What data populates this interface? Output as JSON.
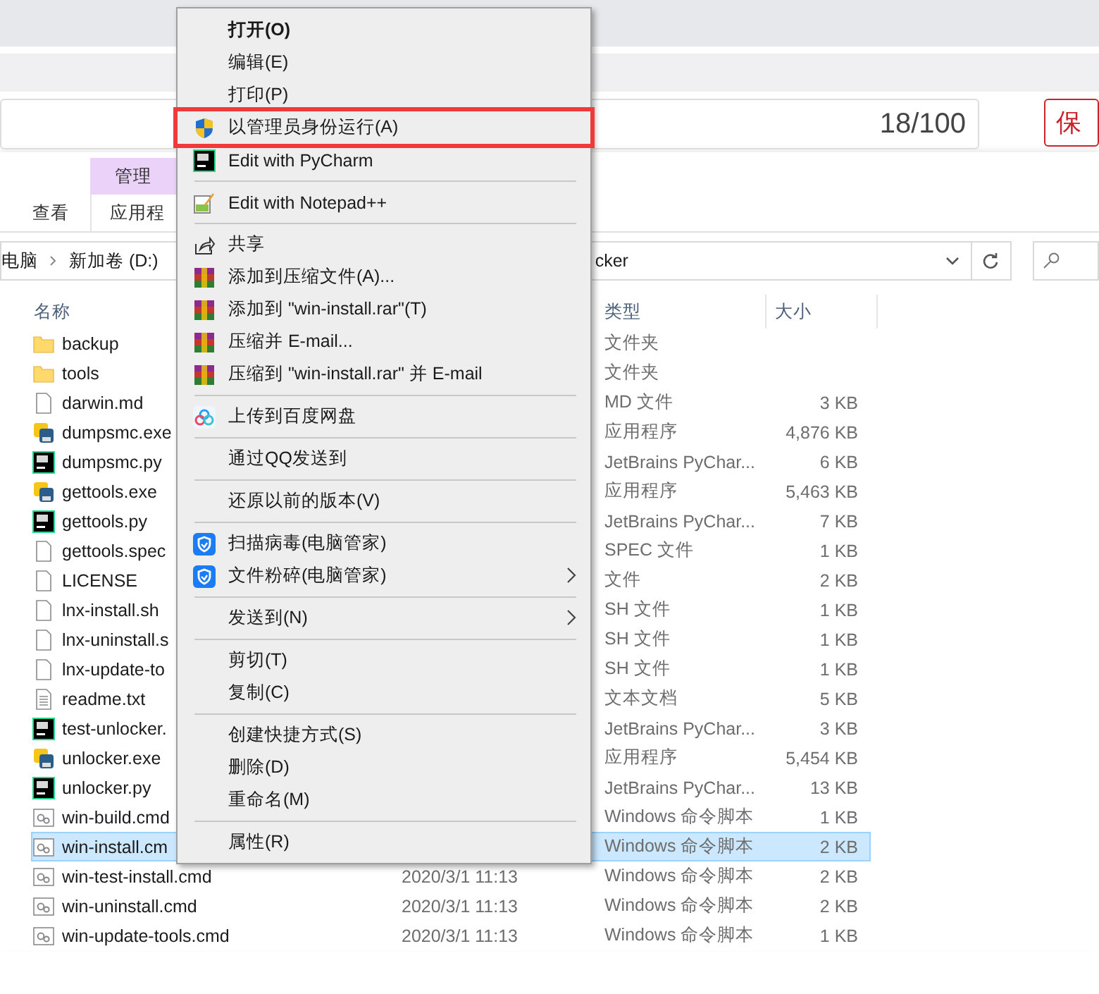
{
  "background": {
    "counter": "18/100",
    "button": "保"
  },
  "ribbon": {
    "context_tab": "管理",
    "tabs": [
      {
        "label": "查看",
        "selected": false
      },
      {
        "label": "应用程",
        "selected": false
      }
    ]
  },
  "address_bar": {
    "crumbs": [
      "电脑",
      "新加卷 (D:)"
    ],
    "tail": "cker"
  },
  "table": {
    "columns": [
      "名称",
      "类型",
      "大小"
    ],
    "rows": [
      {
        "kind": "folder",
        "name": "backup",
        "type": "文件夹",
        "selected": false
      },
      {
        "kind": "folder",
        "name": "tools",
        "type": "文件夹",
        "selected": false
      },
      {
        "kind": "file",
        "name": "darwin.md",
        "type": "MD 文件",
        "size": "3 KB",
        "selected": false
      },
      {
        "kind": "exe",
        "name": "dumpsmc.exe",
        "type": "应用程序",
        "size": "4,876 KB",
        "selected": false
      },
      {
        "kind": "pycharm",
        "name": "dumpsmc.py",
        "type": "JetBrains PyChar...",
        "size": "6 KB",
        "selected": false
      },
      {
        "kind": "exe",
        "name": "gettools.exe",
        "type": "应用程序",
        "size": "5,463 KB",
        "selected": false
      },
      {
        "kind": "pycharm",
        "name": "gettools.py",
        "type": "JetBrains PyChar...",
        "size": "7 KB",
        "selected": false
      },
      {
        "kind": "file",
        "name": "gettools.spec",
        "type": "SPEC 文件",
        "size": "1 KB",
        "selected": false
      },
      {
        "kind": "file",
        "name": "LICENSE",
        "type": "文件",
        "size": "2 KB",
        "selected": false
      },
      {
        "kind": "file",
        "name": "lnx-install.sh",
        "type": "SH 文件",
        "size": "1 KB",
        "selected": false
      },
      {
        "kind": "file",
        "name": "lnx-uninstall.s",
        "type": "SH 文件",
        "size": "1 KB",
        "selected": false
      },
      {
        "kind": "file",
        "name": "lnx-update-to",
        "type": "SH 文件",
        "size": "1 KB",
        "selected": false
      },
      {
        "kind": "text",
        "name": "readme.txt",
        "type": "文本文档",
        "size": "5 KB",
        "selected": false
      },
      {
        "kind": "pycharm",
        "name": "test-unlocker.",
        "type": "JetBrains PyChar...",
        "size": "3 KB",
        "selected": false
      },
      {
        "kind": "exe",
        "name": "unlocker.exe",
        "type": "应用程序",
        "size": "5,454 KB",
        "selected": false
      },
      {
        "kind": "pycharm",
        "name": "unlocker.py",
        "type": "JetBrains PyChar...",
        "size": "13 KB",
        "selected": false
      },
      {
        "kind": "script",
        "name": "win-build.cmd",
        "type": "Windows 命令脚本",
        "size": "1 KB",
        "selected": false
      },
      {
        "kind": "script",
        "name": "win-install.cm",
        "type": "Windows 命令脚本",
        "size": "2 KB",
        "selected": true
      },
      {
        "kind": "script",
        "name": "win-test-install.cmd",
        "date": "2020/3/1 11:13",
        "type": "Windows 命令脚本",
        "size": "2 KB",
        "selected": false
      },
      {
        "kind": "script",
        "name": "win-uninstall.cmd",
        "date": "2020/3/1 11:13",
        "type": "Windows 命令脚本",
        "size": "2 KB",
        "selected": false
      },
      {
        "kind": "script",
        "name": "win-update-tools.cmd",
        "date": "2020/3/1 11:13",
        "type": "Windows 命令脚本",
        "size": "1 KB",
        "selected": false
      }
    ]
  },
  "context_menu": [
    {
      "kind": "plain",
      "label": "打开(O)",
      "bold": true,
      "marked": false,
      "submenu": false
    },
    {
      "kind": "plain",
      "label": "编辑(E)",
      "bold": false,
      "marked": false,
      "submenu": false
    },
    {
      "kind": "plain",
      "label": "打印(P)",
      "bold": false,
      "marked": false,
      "submenu": false
    },
    {
      "kind": "uac",
      "label": "以管理员身份运行(A)",
      "bold": false,
      "marked": true,
      "submenu": false
    },
    {
      "kind": "pycharm",
      "label": "Edit with PyCharm",
      "bold": false,
      "marked": false,
      "submenu": false
    },
    {
      "kind": "separator"
    },
    {
      "kind": "notepad",
      "label": "Edit with Notepad++",
      "bold": false,
      "marked": false,
      "submenu": false
    },
    {
      "kind": "separator"
    },
    {
      "kind": "share",
      "label": "共享",
      "bold": false,
      "marked": false,
      "submenu": false
    },
    {
      "kind": "archive",
      "label": "添加到压缩文件(A)...",
      "bold": false,
      "marked": false,
      "submenu": false
    },
    {
      "kind": "archive",
      "label": "添加到 \"win-install.rar\"(T)",
      "bold": false,
      "marked": false,
      "submenu": false
    },
    {
      "kind": "archive",
      "label": "压缩并 E-mail...",
      "bold": false,
      "marked": false,
      "submenu": false
    },
    {
      "kind": "archive",
      "label": "压缩到 \"win-install.rar\" 并 E-mail",
      "bold": false,
      "marked": false,
      "submenu": false
    },
    {
      "kind": "separator"
    },
    {
      "kind": "cloud",
      "label": "上传到百度网盘",
      "bold": false,
      "marked": false,
      "submenu": false
    },
    {
      "kind": "separator"
    },
    {
      "kind": "plain",
      "label": "通过QQ发送到",
      "bold": false,
      "marked": false,
      "submenu": false
    },
    {
      "kind": "separator"
    },
    {
      "kind": "plain",
      "label": "还原以前的版本(V)",
      "bold": false,
      "marked": false,
      "submenu": false
    },
    {
      "kind": "separator"
    },
    {
      "kind": "guard",
      "label": "扫描病毒(电脑管家)",
      "bold": false,
      "marked": false,
      "submenu": false
    },
    {
      "kind": "guard",
      "label": "文件粉碎(电脑管家)",
      "bold": false,
      "marked": false,
      "submenu": true
    },
    {
      "kind": "separator"
    },
    {
      "kind": "plain",
      "label": "发送到(N)",
      "bold": false,
      "marked": false,
      "submenu": true
    },
    {
      "kind": "separator"
    },
    {
      "kind": "plain",
      "label": "剪切(T)",
      "bold": false,
      "marked": false,
      "submenu": false
    },
    {
      "kind": "plain",
      "label": "复制(C)",
      "bold": false,
      "marked": false,
      "submenu": false
    },
    {
      "kind": "separator"
    },
    {
      "kind": "plain",
      "label": "创建快捷方式(S)",
      "bold": false,
      "marked": false,
      "submenu": false
    },
    {
      "kind": "plain",
      "label": "删除(D)",
      "bold": false,
      "marked": false,
      "submenu": false
    },
    {
      "kind": "plain",
      "label": "重命名(M)",
      "bold": false,
      "marked": false,
      "submenu": false
    },
    {
      "kind": "separator"
    },
    {
      "kind": "plain",
      "label": "属性(R)",
      "bold": false,
      "marked": false,
      "submenu": false
    }
  ]
}
